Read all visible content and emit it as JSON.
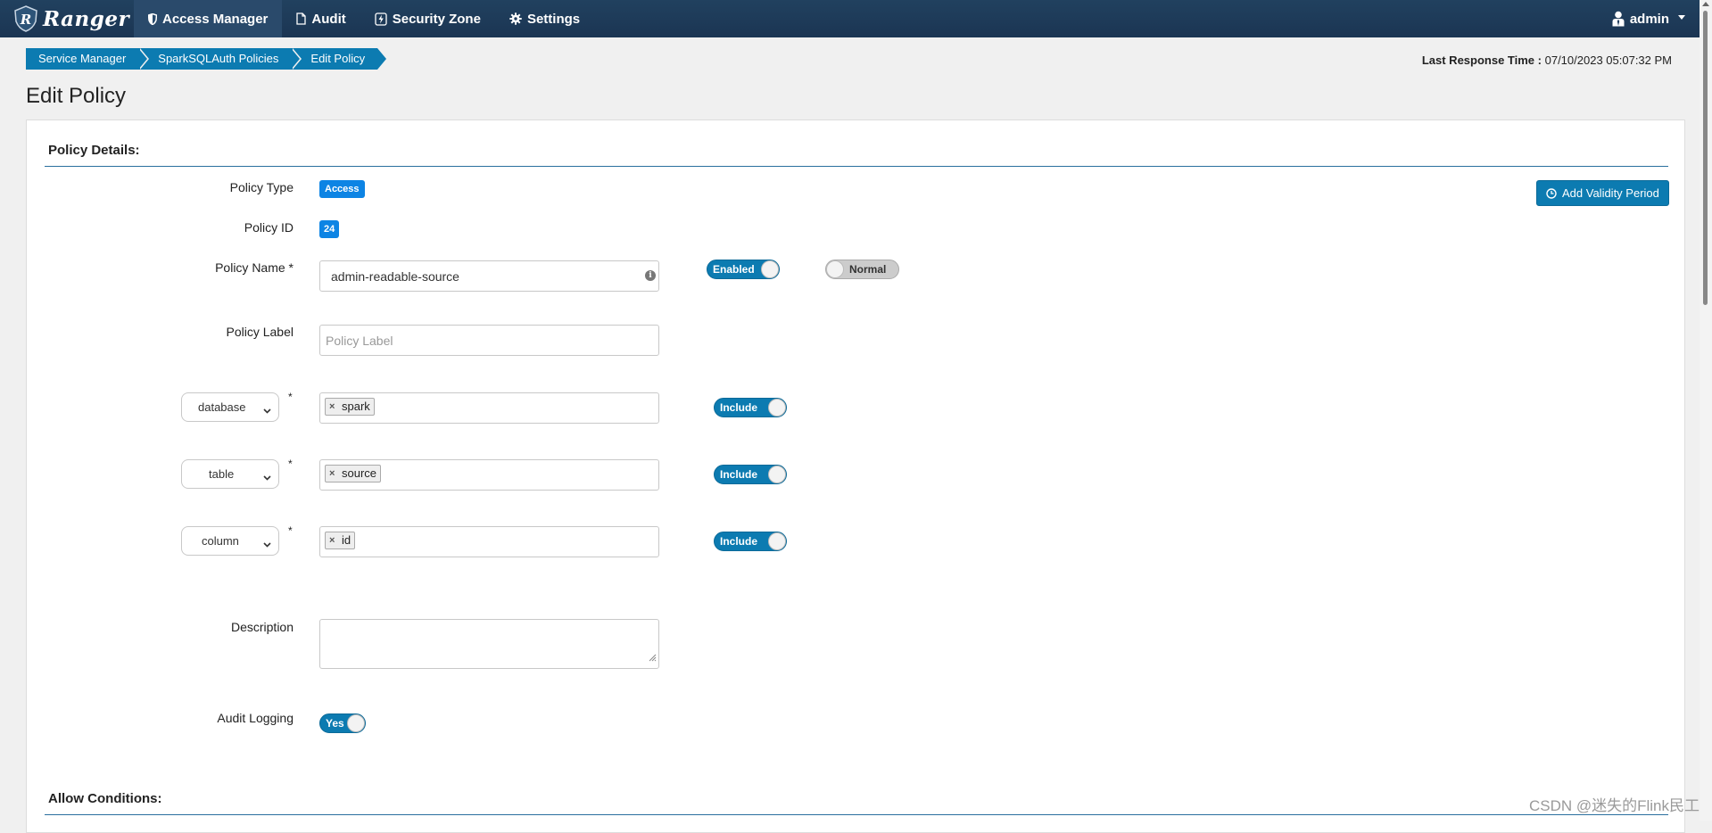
{
  "nav": {
    "brand": "Ranger",
    "items": [
      {
        "label": "Access Manager",
        "icon": "shield-icon",
        "active": true
      },
      {
        "label": "Audit",
        "icon": "file-icon",
        "active": false
      },
      {
        "label": "Security Zone",
        "icon": "bolt-icon",
        "active": false
      },
      {
        "label": "Settings",
        "icon": "gear-icon",
        "active": false
      }
    ],
    "user": "admin"
  },
  "breadcrumb": [
    "Service Manager",
    "SparkSQLAuth Policies",
    "Edit Policy"
  ],
  "last_response": {
    "label": "Last Response Time :",
    "value": "07/10/2023 05:07:32 PM"
  },
  "page_title": "Edit Policy",
  "policy_details": {
    "title": "Policy Details:",
    "policy_type_label": "Policy Type",
    "policy_type": "Access",
    "policy_id_label": "Policy ID",
    "policy_id": "24",
    "policy_name_label": "Policy Name *",
    "policy_name": "admin-readable-source",
    "enabled_toggle": "Enabled",
    "priority_toggle": "Normal",
    "add_validity": "Add Validity Period",
    "policy_label_label": "Policy Label",
    "policy_label_placeholder": "Policy Label",
    "resources": [
      {
        "type": "database",
        "value": "spark",
        "toggle": "Include"
      },
      {
        "type": "table",
        "value": "source",
        "toggle": "Include"
      },
      {
        "type": "column",
        "value": "id",
        "toggle": "Include"
      }
    ],
    "required_mark": "*",
    "tag_remove": "×",
    "description_label": "Description",
    "audit_logging_label": "Audit Logging",
    "audit_logging": "Yes"
  },
  "allow_conditions": {
    "title": "Allow Conditions:"
  },
  "watermark": "CSDN @迷失的Flink民工",
  "colors": {
    "navbar": "#1e3a5a",
    "accent": "#0c7bb1",
    "badge": "#0d84e4"
  }
}
